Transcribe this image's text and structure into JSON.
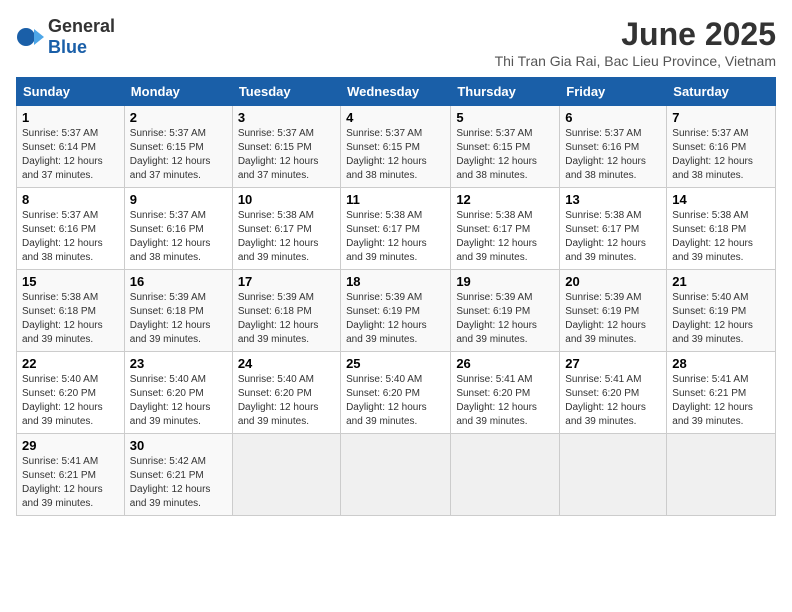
{
  "logo": {
    "general": "General",
    "blue": "Blue"
  },
  "header": {
    "month": "June 2025",
    "location": "Thi Tran Gia Rai, Bac Lieu Province, Vietnam"
  },
  "days_of_week": [
    "Sunday",
    "Monday",
    "Tuesday",
    "Wednesday",
    "Thursday",
    "Friday",
    "Saturday"
  ],
  "weeks": [
    [
      {
        "day": "1",
        "sunrise": "5:37 AM",
        "sunset": "6:14 PM",
        "daylight": "12 hours and 37 minutes."
      },
      {
        "day": "2",
        "sunrise": "5:37 AM",
        "sunset": "6:15 PM",
        "daylight": "12 hours and 37 minutes."
      },
      {
        "day": "3",
        "sunrise": "5:37 AM",
        "sunset": "6:15 PM",
        "daylight": "12 hours and 37 minutes."
      },
      {
        "day": "4",
        "sunrise": "5:37 AM",
        "sunset": "6:15 PM",
        "daylight": "12 hours and 38 minutes."
      },
      {
        "day": "5",
        "sunrise": "5:37 AM",
        "sunset": "6:15 PM",
        "daylight": "12 hours and 38 minutes."
      },
      {
        "day": "6",
        "sunrise": "5:37 AM",
        "sunset": "6:16 PM",
        "daylight": "12 hours and 38 minutes."
      },
      {
        "day": "7",
        "sunrise": "5:37 AM",
        "sunset": "6:16 PM",
        "daylight": "12 hours and 38 minutes."
      }
    ],
    [
      {
        "day": "8",
        "sunrise": "5:37 AM",
        "sunset": "6:16 PM",
        "daylight": "12 hours and 38 minutes."
      },
      {
        "day": "9",
        "sunrise": "5:37 AM",
        "sunset": "6:16 PM",
        "daylight": "12 hours and 38 minutes."
      },
      {
        "day": "10",
        "sunrise": "5:38 AM",
        "sunset": "6:17 PM",
        "daylight": "12 hours and 39 minutes."
      },
      {
        "day": "11",
        "sunrise": "5:38 AM",
        "sunset": "6:17 PM",
        "daylight": "12 hours and 39 minutes."
      },
      {
        "day": "12",
        "sunrise": "5:38 AM",
        "sunset": "6:17 PM",
        "daylight": "12 hours and 39 minutes."
      },
      {
        "day": "13",
        "sunrise": "5:38 AM",
        "sunset": "6:17 PM",
        "daylight": "12 hours and 39 minutes."
      },
      {
        "day": "14",
        "sunrise": "5:38 AM",
        "sunset": "6:18 PM",
        "daylight": "12 hours and 39 minutes."
      }
    ],
    [
      {
        "day": "15",
        "sunrise": "5:38 AM",
        "sunset": "6:18 PM",
        "daylight": "12 hours and 39 minutes."
      },
      {
        "day": "16",
        "sunrise": "5:39 AM",
        "sunset": "6:18 PM",
        "daylight": "12 hours and 39 minutes."
      },
      {
        "day": "17",
        "sunrise": "5:39 AM",
        "sunset": "6:18 PM",
        "daylight": "12 hours and 39 minutes."
      },
      {
        "day": "18",
        "sunrise": "5:39 AM",
        "sunset": "6:19 PM",
        "daylight": "12 hours and 39 minutes."
      },
      {
        "day": "19",
        "sunrise": "5:39 AM",
        "sunset": "6:19 PM",
        "daylight": "12 hours and 39 minutes."
      },
      {
        "day": "20",
        "sunrise": "5:39 AM",
        "sunset": "6:19 PM",
        "daylight": "12 hours and 39 minutes."
      },
      {
        "day": "21",
        "sunrise": "5:40 AM",
        "sunset": "6:19 PM",
        "daylight": "12 hours and 39 minutes."
      }
    ],
    [
      {
        "day": "22",
        "sunrise": "5:40 AM",
        "sunset": "6:20 PM",
        "daylight": "12 hours and 39 minutes."
      },
      {
        "day": "23",
        "sunrise": "5:40 AM",
        "sunset": "6:20 PM",
        "daylight": "12 hours and 39 minutes."
      },
      {
        "day": "24",
        "sunrise": "5:40 AM",
        "sunset": "6:20 PM",
        "daylight": "12 hours and 39 minutes."
      },
      {
        "day": "25",
        "sunrise": "5:40 AM",
        "sunset": "6:20 PM",
        "daylight": "12 hours and 39 minutes."
      },
      {
        "day": "26",
        "sunrise": "5:41 AM",
        "sunset": "6:20 PM",
        "daylight": "12 hours and 39 minutes."
      },
      {
        "day": "27",
        "sunrise": "5:41 AM",
        "sunset": "6:20 PM",
        "daylight": "12 hours and 39 minutes."
      },
      {
        "day": "28",
        "sunrise": "5:41 AM",
        "sunset": "6:21 PM",
        "daylight": "12 hours and 39 minutes."
      }
    ],
    [
      {
        "day": "29",
        "sunrise": "5:41 AM",
        "sunset": "6:21 PM",
        "daylight": "12 hours and 39 minutes."
      },
      {
        "day": "30",
        "sunrise": "5:42 AM",
        "sunset": "6:21 PM",
        "daylight": "12 hours and 39 minutes."
      },
      null,
      null,
      null,
      null,
      null
    ]
  ]
}
